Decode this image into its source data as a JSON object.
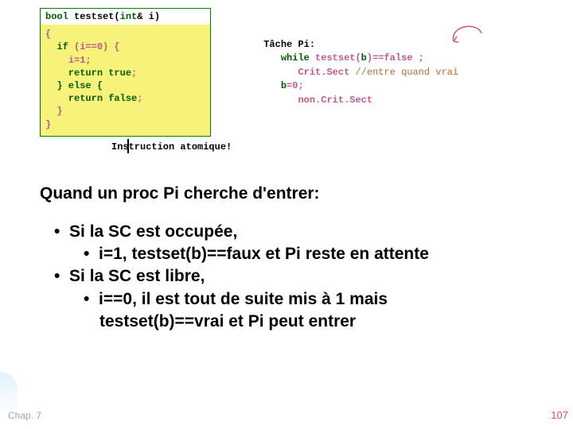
{
  "code": {
    "signature_kw1": "bool",
    "signature_name": "testset(",
    "signature_kw2": "int",
    "signature_rest": "& i)",
    "l1": "{",
    "l2_kw": "if",
    "l2_rest": " (i==0) {",
    "l3": "i=1;",
    "l4_kw": "return true",
    "l4_rest": ";",
    "l5_kw": "} else {",
    "l6_kw": "return false",
    "l6_rest": ";",
    "l7": "}",
    "l8": "}"
  },
  "atomic_label": "Instruction atomique!",
  "task": {
    "title": "Tâche Pi:",
    "l1_kw": "while",
    "l1_rest": " testset(",
    "l1_var": "b",
    "l1_tail": ")==false ;",
    "l2": "Crit.Sect",
    "l2_cm": " //entre quand vrai",
    "l3_var": "b",
    "l3_rest": "=0;",
    "l4": "non.Crit.Sect"
  },
  "heading": "Quand un proc Pi cherche d'entrer:",
  "bullets": {
    "a": "Si la SC est occupée,",
    "a1": "i=1, testset(b)==faux et Pi reste en attente",
    "b": "Si la SC est libre,",
    "b1": "i==0, il est tout de suite mis à 1 mais",
    "b1c": "testset(b)==vrai et Pi peut entrer"
  },
  "footer": {
    "left": "Chap. 7",
    "right": "107"
  }
}
